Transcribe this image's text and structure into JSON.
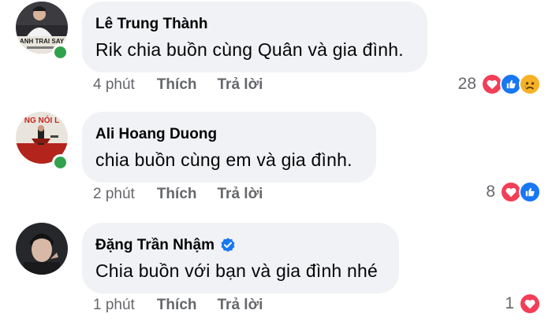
{
  "colors": {
    "bubble_bg": "#f0f2f5",
    "meta_text": "#65676b",
    "online": "#31a24c",
    "love": "#f33e58",
    "like": "#1877f2",
    "sad": "#f7b125",
    "verified": "#1877f2"
  },
  "comments": [
    {
      "author": "Lê Trung Thành",
      "verified": false,
      "online": true,
      "text": "Rik chia buồn cùng Quân và gia đình.",
      "time": "4 phút",
      "like_label": "Thích",
      "reply_label": "Trả lời",
      "reaction_count": "28",
      "reactions": [
        "love-icon",
        "like-icon",
        "sad-icon"
      ],
      "avatar_text": "ANH TRAI SAY",
      "avatar_icon": "avatar-man-white-shirt"
    },
    {
      "author": "Ali Hoang Duong",
      "verified": false,
      "online": true,
      "text": "chia buồn cùng em và gia đình.",
      "time": "2 phút",
      "like_label": "Thích",
      "reply_label": "Trả lời",
      "reaction_count": "8",
      "reactions": [
        "love-icon",
        "like-icon"
      ],
      "avatar_text": "NG NÓI L",
      "avatar_icon": "avatar-poster-red"
    },
    {
      "author": "Đặng Trần Nhậm",
      "verified": true,
      "online": false,
      "text": "Chia buồn với bạn và gia đình nhé",
      "time": "1 phút",
      "like_label": "Thích",
      "reply_label": "Trả lời",
      "reaction_count": "1",
      "reactions": [
        "love-icon"
      ],
      "avatar_icon": "avatar-man-dark"
    }
  ]
}
